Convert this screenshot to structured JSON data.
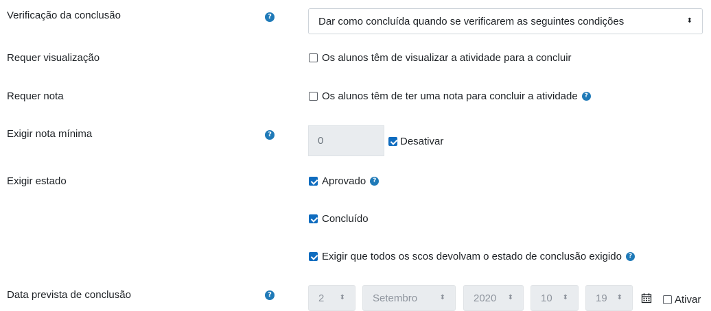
{
  "rows": {
    "completion_check": {
      "label": "Verificação da conclusão",
      "select_value": "Dar como concluída quando se verificarem as seguintes condições"
    },
    "require_view": {
      "label": "Requer visualização",
      "checkbox_label": "Os alunos têm de visualizar a atividade para a concluir",
      "checked": false
    },
    "require_grade": {
      "label": "Requer nota",
      "checkbox_label": "Os alunos têm de ter uma nota para concluir a atividade",
      "checked": false
    },
    "min_grade": {
      "label": "Exigir nota mínima",
      "value": "0",
      "disable_label": "Desativar",
      "disable_checked": true
    },
    "require_status": {
      "label": "Exigir estado",
      "options": [
        {
          "label": "Aprovado",
          "checked": true
        },
        {
          "label": "Concluído",
          "checked": true
        },
        {
          "label": "Exigir que todos os scos devolvam o estado de conclusão exigido",
          "checked": true
        }
      ]
    },
    "expected_date": {
      "label": "Data prevista de conclusão",
      "day": "2",
      "month": "Setembro",
      "year": "2020",
      "hour": "10",
      "minute": "19",
      "enable_label": "Ativar",
      "enable_checked": false
    }
  },
  "help_glyph": "?",
  "caret_glyph": "⬍",
  "colors": {
    "accent": "#0f6cbf",
    "help": "#1f7ab8",
    "disabled_bg": "#e9ecef"
  }
}
